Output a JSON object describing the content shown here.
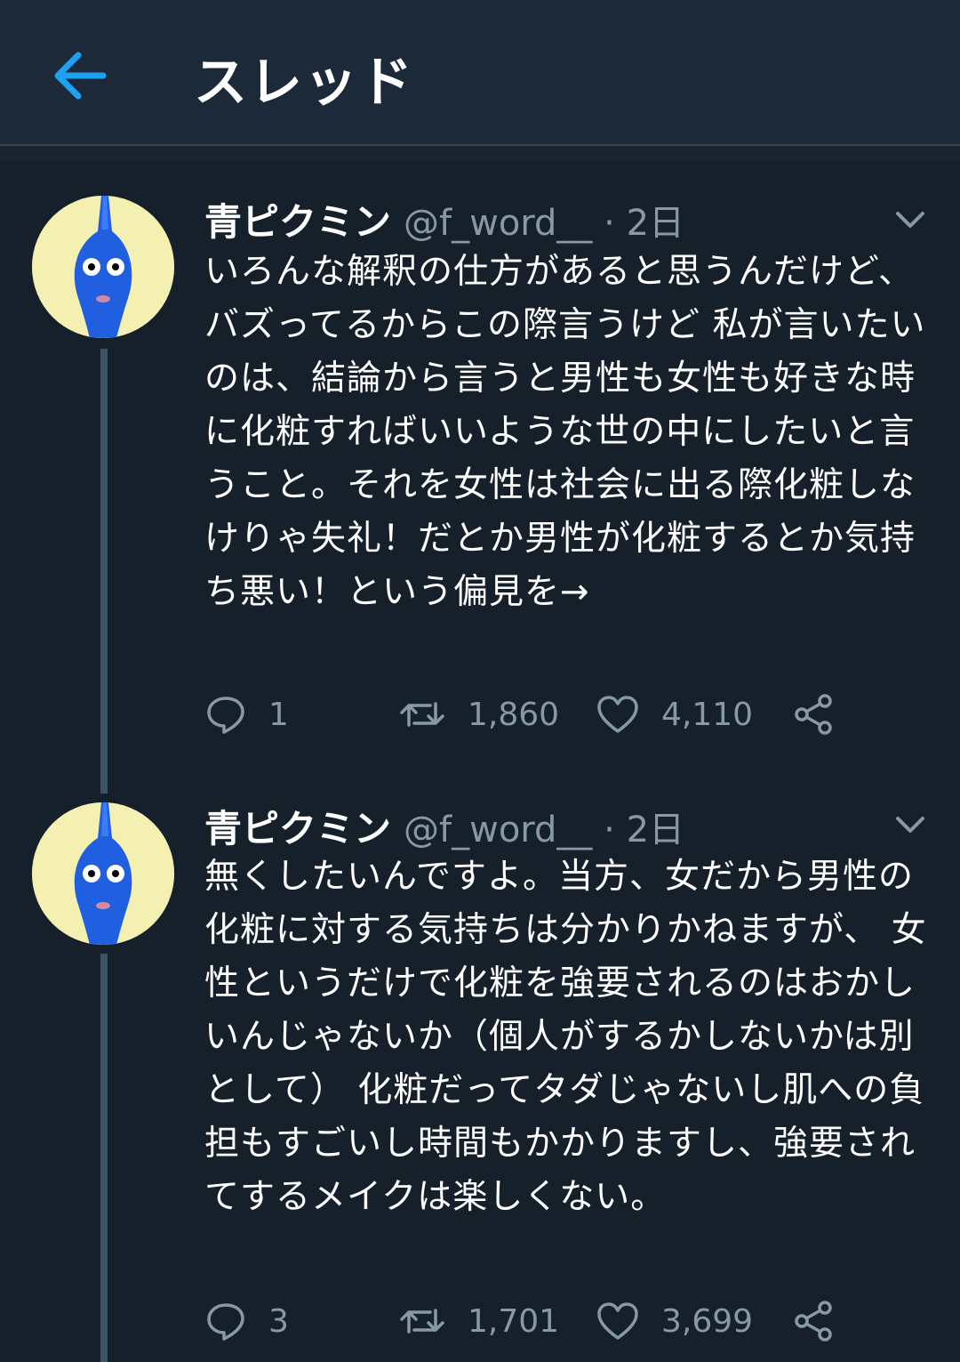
{
  "header": {
    "title": "スレッド",
    "back_icon": "arrow-left-icon",
    "accent": "#1da1f2"
  },
  "tweets": [
    {
      "display_name": "青ピクミン",
      "handle": "@f_word__",
      "separator": "·",
      "time": "2日",
      "text": "いろんな解釈の仕方があると思うんだけど、バズってるからこの際言うけど 私が言いたいのは、結論から言うと男性も女性も好きな時に化粧すればいいような世の中にしたいと言うこと。それを女性は社会に出る際化粧しなけりゃ失礼！だとか男性が化粧するとか気持ち悪い！という偏見を→",
      "replies": "1",
      "retweets": "1,860",
      "likes": "4,110"
    },
    {
      "display_name": "青ピクミン",
      "handle": "@f_word__",
      "separator": "·",
      "time": "2日",
      "text": "無くしたいんですよ。当方、女だから男性の化粧に対する気持ちは分かりかねますが、 女性というだけで化粧を強要されるのはおかしいんじゃないか（個人がするかしないかは別として） 化粧だってタダじゃないし肌への負担もすごいし時間もかかりますし、強要されてするメイクは楽しくない。",
      "replies": "3",
      "retweets": "1,701",
      "likes": "3,699"
    }
  ],
  "colors": {
    "background": "#15202b",
    "header": "#1c2938",
    "secondary_text": "#8899a6",
    "thread_line": "#3d5466",
    "avatar_bg": "#f4f0b2",
    "pikmin_blue": "#1f5fe0"
  }
}
